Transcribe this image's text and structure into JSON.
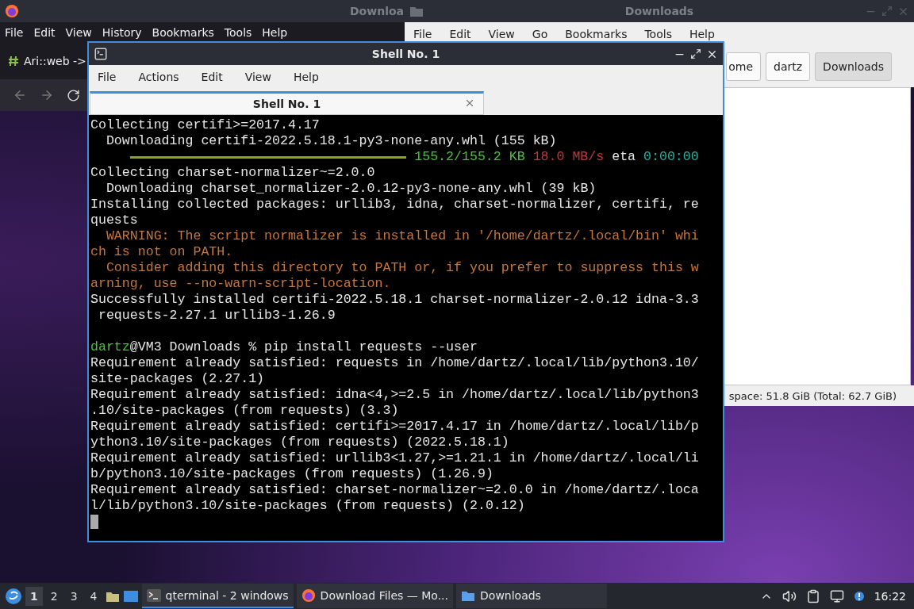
{
  "firefox": {
    "title": "Downloa",
    "menu": [
      "File",
      "Edit",
      "View",
      "History",
      "Bookmarks",
      "Tools",
      "Help"
    ],
    "tab": "Ari::web ->"
  },
  "file_manager": {
    "title": "Downloads",
    "menu": [
      "File",
      "Edit",
      "View",
      "Go",
      "Bookmarks",
      "Tools",
      "Help"
    ],
    "path": [
      {
        "label": "ome",
        "selected": false
      },
      {
        "label": "dartz",
        "selected": false
      },
      {
        "label": "Downloads",
        "selected": true
      }
    ],
    "status": "space: 51.8 GiB (Total: 62.7 GiB)"
  },
  "terminal": {
    "title": "Shell No. 1",
    "menu": [
      "File",
      "Actions",
      "Edit",
      "View",
      "Help"
    ],
    "tabs": [
      {
        "label": "Shell No. 1",
        "selected": true
      }
    ],
    "lines": [
      {
        "kind": "text",
        "spans": [
          {
            "text": "Collecting certifi>=2017.4.17",
            "kind": "plain"
          }
        ]
      },
      {
        "kind": "text",
        "spans": [
          {
            "text": "  Downloading certifi-2022.5.18.1-py3-none-any.whl (155 kB)",
            "kind": "plain"
          }
        ]
      },
      {
        "kind": "progress",
        "level": 1,
        "spans": [
          {
            "text": "155.2/155.2 KB",
            "kind": "green"
          },
          {
            "text": "18.0 MB/s",
            "kind": "red"
          },
          {
            "text": "eta",
            "kind": "plain"
          },
          {
            "text": "0:00:00",
            "kind": "cyan"
          }
        ]
      },
      {
        "kind": "text",
        "spans": [
          {
            "text": "Collecting charset-normalizer~=2.0.0",
            "kind": "plain"
          }
        ]
      },
      {
        "kind": "text",
        "spans": [
          {
            "text": "  Downloading charset_normalizer-2.0.12-py3-none-any.whl (39 kB)",
            "kind": "plain"
          }
        ]
      },
      {
        "kind": "text",
        "spans": [
          {
            "text": "Installing collected packages: urllib3, idna, charset-normalizer, certifi, re",
            "kind": "plain"
          }
        ]
      },
      {
        "kind": "text",
        "spans": [
          {
            "text": "quests",
            "kind": "plain"
          }
        ]
      },
      {
        "kind": "text",
        "spans": [
          {
            "text": "  WARNING: The script normalizer is installed in '/home/dartz/.local/bin' whi",
            "kind": "warning"
          }
        ]
      },
      {
        "kind": "text",
        "spans": [
          {
            "text": "ch is not on PATH.",
            "kind": "warning"
          }
        ]
      },
      {
        "kind": "text",
        "spans": [
          {
            "text": "  Consider adding this directory to PATH or, if you prefer to suppress this w",
            "kind": "warning"
          }
        ]
      },
      {
        "kind": "text",
        "spans": [
          {
            "text": "arning, use --no-warn-script-location.",
            "kind": "warning"
          }
        ]
      },
      {
        "kind": "text",
        "spans": [
          {
            "text": "Successfully installed certifi-2022.5.18.1 charset-normalizer-2.0.12 idna-3.3",
            "kind": "plain"
          }
        ]
      },
      {
        "kind": "text",
        "spans": [
          {
            "text": " requests-2.27.1 urllib3-1.26.9",
            "kind": "plain"
          }
        ]
      },
      {
        "kind": "blank"
      },
      {
        "kind": "text",
        "spans": [
          {
            "text": "dartz",
            "kind": "prompt"
          },
          {
            "text": "@VM3 Downloads % pip install requests --user",
            "kind": "plain"
          }
        ]
      },
      {
        "kind": "text",
        "spans": [
          {
            "text": "Requirement already satisfied: requests in /home/dartz/.local/lib/python3.10/",
            "kind": "plain"
          }
        ]
      },
      {
        "kind": "text",
        "spans": [
          {
            "text": "site-packages (2.27.1)",
            "kind": "plain"
          }
        ]
      },
      {
        "kind": "text",
        "spans": [
          {
            "text": "Requirement already satisfied: idna<4,>=2.5 in /home/dartz/.local/lib/python3",
            "kind": "plain"
          }
        ]
      },
      {
        "kind": "text",
        "spans": [
          {
            "text": ".10/site-packages (from requests) (3.3)",
            "kind": "plain"
          }
        ]
      },
      {
        "kind": "text",
        "spans": [
          {
            "text": "Requirement already satisfied: certifi>=2017.4.17 in /home/dartz/.local/lib/p",
            "kind": "plain"
          }
        ]
      },
      {
        "kind": "text",
        "spans": [
          {
            "text": "ython3.10/site-packages (from requests) (2022.5.18.1)",
            "kind": "plain"
          }
        ]
      },
      {
        "kind": "text",
        "spans": [
          {
            "text": "Requirement already satisfied: urllib3<1.27,>=1.21.1 in /home/dartz/.local/li",
            "kind": "plain"
          }
        ]
      },
      {
        "kind": "text",
        "spans": [
          {
            "text": "b/python3.10/site-packages (from requests) (1.26.9)",
            "kind": "plain"
          }
        ]
      },
      {
        "kind": "text",
        "spans": [
          {
            "text": "Requirement already satisfied: charset-normalizer~=2.0.0 in /home/dartz/.loca",
            "kind": "plain"
          }
        ]
      },
      {
        "kind": "text",
        "spans": [
          {
            "text": "l/lib/python3.10/site-packages (from requests) (2.0.12)",
            "kind": "plain"
          }
        ]
      },
      {
        "kind": "cursor"
      }
    ]
  },
  "taskbar": {
    "workspaces": [
      {
        "label": "1",
        "selected": true
      },
      {
        "label": "2",
        "selected": false
      },
      {
        "label": "3",
        "selected": false
      },
      {
        "label": "4",
        "selected": false
      }
    ],
    "tasks": [
      {
        "label": "qterminal - 2 windows",
        "kind": "terminal",
        "selected": true
      },
      {
        "label": "Download Files — Mo...",
        "kind": "browser",
        "selected": false
      },
      {
        "label": "Downloads",
        "kind": "folder",
        "selected": false
      }
    ],
    "clock": "16:22"
  }
}
